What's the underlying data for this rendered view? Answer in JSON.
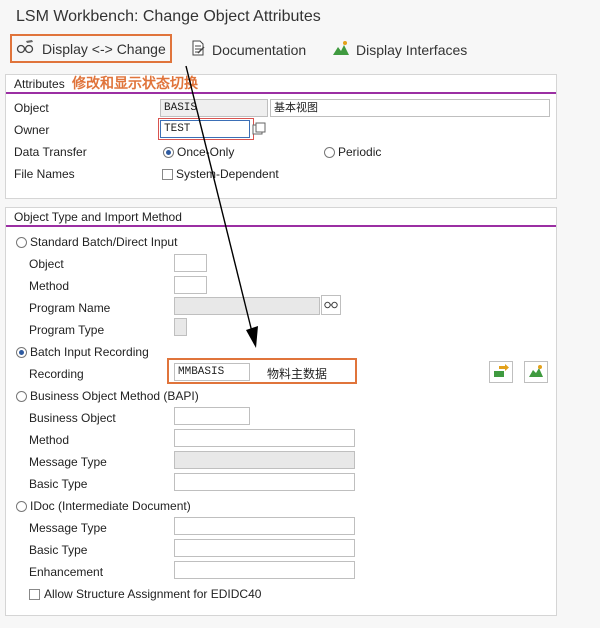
{
  "window": {
    "title": "LSM Workbench: Change Object Attributes"
  },
  "toolbar": {
    "display_change_label": "Display <-> Change",
    "documentation_label": "Documentation",
    "display_interfaces_label": "Display Interfaces"
  },
  "annotation": {
    "text": "修改和显示状态切换",
    "color": "#e0743b"
  },
  "attributes": {
    "group_title": "Attributes",
    "object_label": "Object",
    "object_value": "BASIS",
    "object_desc": "基本视图",
    "owner_label": "Owner",
    "owner_value": "TEST",
    "transfer_label": "Data Transfer",
    "transfer_once": "Once-Only",
    "transfer_periodic": "Periodic",
    "transfer_selected": "Once-Only",
    "filenames_label": "File Names",
    "system_dependent": "System-Dependent",
    "system_dependent_checked": false
  },
  "import_method": {
    "group_title": "Object Type and Import Method",
    "standard": {
      "label": "Standard Batch/Direct Input",
      "object_label": "Object",
      "method_label": "Method",
      "program_name_label": "Program Name",
      "program_type_label": "Program Type"
    },
    "batch": {
      "label": "Batch Input Recording",
      "recording_label": "Recording",
      "recording_value": "MMBASIS",
      "recording_desc": "物料主数据",
      "selected": true
    },
    "bapi": {
      "label": "Business Object Method  (BAPI)",
      "business_object_label": "Business Object",
      "method_label": "Method",
      "message_type_label": "Message Type",
      "basic_type_label": "Basic Type"
    },
    "idoc": {
      "label": "IDoc (Intermediate Document)",
      "message_type_label": "Message Type",
      "basic_type_label": "Basic Type",
      "enhancement_label": "Enhancement",
      "allow_structure_label": "Allow Structure Assignment for EDIDC40",
      "allow_structure_checked": false
    }
  },
  "colors": {
    "accent": "#9b2fa3",
    "highlight": "#e0743b",
    "selected": "#2d5aa0"
  }
}
